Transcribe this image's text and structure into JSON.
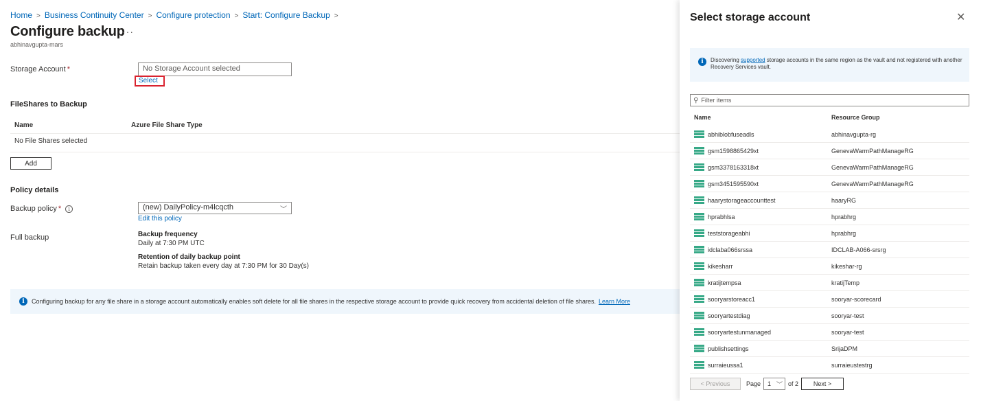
{
  "breadcrumb": {
    "items": [
      "Home",
      "Business Continuity Center",
      "Configure protection",
      "Start: Configure Backup"
    ],
    "separator": ">"
  },
  "page": {
    "title": "Configure backup",
    "more": "···",
    "subtitle": "abhinavgupta-mars"
  },
  "storage": {
    "label": "Storage Account",
    "required_mark": "*",
    "value": "No Storage Account selected",
    "select_label": "Select"
  },
  "fileshares": {
    "title": "FileShares to Backup",
    "columns": [
      "Name",
      "Azure File Share Type"
    ],
    "empty": "No File Shares selected",
    "add_label": "Add"
  },
  "policy": {
    "title": "Policy details",
    "backup_policy_label": "Backup policy",
    "required_mark": "*",
    "info_glyph": "i",
    "selected": "(new) DailyPolicy-m4lcqcth",
    "edit_label": "Edit this policy",
    "full_backup_label": "Full backup",
    "frequency_title": "Backup frequency",
    "frequency_value": "Daily at 7:30 PM UTC",
    "retention_title": "Retention of daily backup point",
    "retention_value": "Retain backup taken every day at 7:30 PM for 30 Day(s)"
  },
  "info_bar": {
    "glyph": "i",
    "text": "Configuring backup for any file share in a storage account automatically enables soft delete for all file shares in the respective storage account to provide quick recovery from accidental deletion of file shares.",
    "link": "Learn More"
  },
  "panel": {
    "title": "Select storage account",
    "close_glyph": "✕",
    "info_glyph": "i",
    "info_prefix": "Discovering",
    "info_link": "supported",
    "info_suffix": "storage accounts in the same region as the vault and not registered with another Recovery Services vault.",
    "filter_placeholder": "Filter items",
    "columns": [
      "Name",
      "Resource Group"
    ],
    "rows": [
      {
        "name": "abhiblobfuseadls",
        "rg": "abhinavgupta-rg"
      },
      {
        "name": "gsm1598865429xt",
        "rg": "GenevaWarmPathManageRG"
      },
      {
        "name": "gsm3378163318xt",
        "rg": "GenevaWarmPathManageRG"
      },
      {
        "name": "gsm3451595590xt",
        "rg": "GenevaWarmPathManageRG"
      },
      {
        "name": "haarystorageaccounttest",
        "rg": "haaryRG"
      },
      {
        "name": "hprabhlsa",
        "rg": "hprabhrg"
      },
      {
        "name": "teststorageabhi",
        "rg": "hprabhrg"
      },
      {
        "name": "idclaba066srssa",
        "rg": "IDCLAB-A066-srsrg"
      },
      {
        "name": "kikesharr",
        "rg": "kikeshar-rg"
      },
      {
        "name": "kratijtempsa",
        "rg": "kratijTemp"
      },
      {
        "name": "sooryarstoreacc1",
        "rg": "sooryar-scorecard"
      },
      {
        "name": "sooryartestdiag",
        "rg": "sooryar-test"
      },
      {
        "name": "sooryartestunmanaged",
        "rg": "sooryar-test"
      },
      {
        "name": "publishsettings",
        "rg": "SrijaDPM"
      },
      {
        "name": "surraieussa1",
        "rg": "surraieustestrg"
      }
    ],
    "pager": {
      "prev_label": "< Previous",
      "page_label": "Page",
      "current_page": "1",
      "of_label": "of 2",
      "next_label": "Next >"
    }
  },
  "colors": {
    "link": "#0067b8",
    "highlight_box": "#d9232f",
    "info_background": "#eff6fc",
    "storage_icon": "#37a987"
  }
}
